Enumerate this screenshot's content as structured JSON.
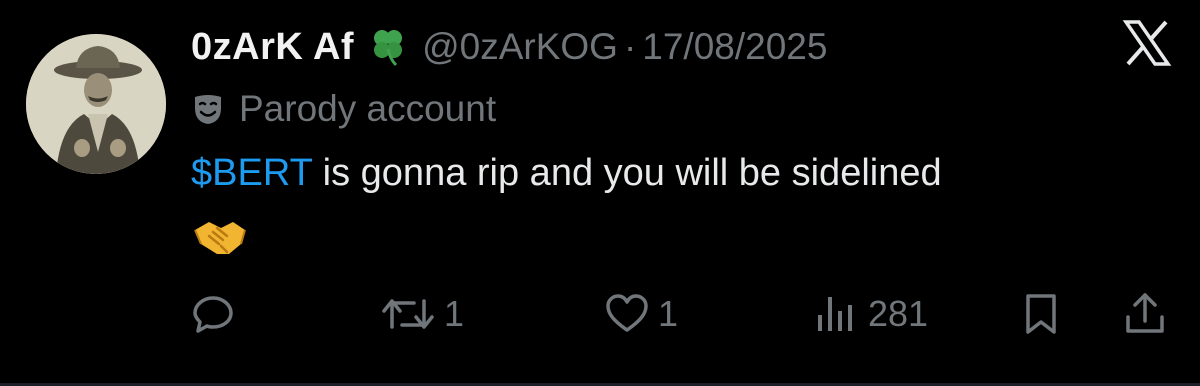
{
  "author": {
    "display_name": "0zArK Af",
    "handle": "@0zArKOG",
    "separator": "·",
    "date": "17/08/2025",
    "badge_icon": "four-leaf-clover-icon",
    "avatar": "vintage-photo-avatar"
  },
  "label": {
    "icon": "theater-mask-icon",
    "text": "Parody account"
  },
  "tweet": {
    "cashtag": "$BERT",
    "text": " is gonna rip and you will be sidelined",
    "emoji": "handshake-emoji"
  },
  "actions": {
    "reply": {
      "icon": "reply-icon",
      "count": ""
    },
    "retweet": {
      "icon": "retweet-icon",
      "count": "1"
    },
    "like": {
      "icon": "heart-icon",
      "count": "1"
    },
    "views": {
      "icon": "views-chart-icon",
      "count": "281"
    },
    "bookmark": {
      "icon": "bookmark-icon"
    },
    "share": {
      "icon": "share-icon"
    }
  },
  "platform_logo": "x-logo",
  "colors": {
    "background": "#000000",
    "text": "#e7e9ea",
    "muted": "#71767b",
    "link": "#1d9bf0"
  }
}
